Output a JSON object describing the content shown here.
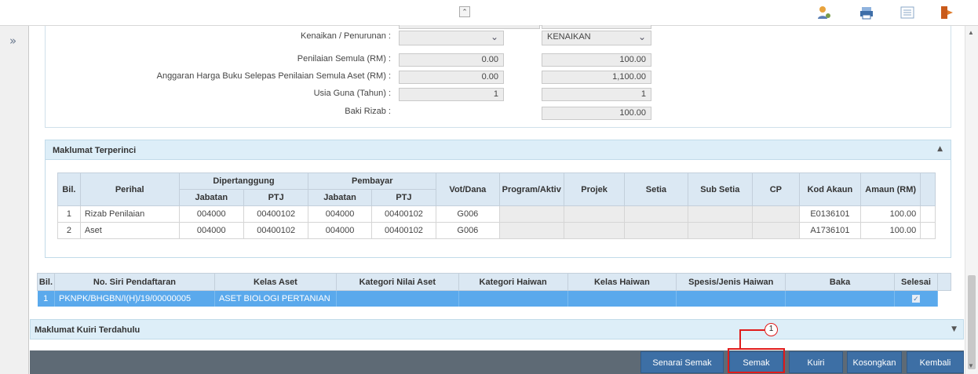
{
  "topbar": {
    "collapse_glyph": "⌃",
    "icons": [
      "user-settings-icon",
      "printer-icon",
      "list-view-icon",
      "logout-icon"
    ]
  },
  "left_rail": {
    "expand_glyph": "»"
  },
  "form": {
    "kenaikan_label": "Kenaikan / Penurunan :",
    "kenaikan_value": "KENAIKAN",
    "penilaian_label": "Penilaian Semula (RM) :",
    "penilaian_old": "0.00",
    "penilaian_new": "100.00",
    "anggaran_label": "Anggaran Harga Buku Selepas Penilaian Semula Aset (RM) :",
    "anggaran_old": "0.00",
    "anggaran_new": "1,100.00",
    "usia_label": "Usia Guna (Tahun) :",
    "usia_old": "1",
    "usia_new": "1",
    "baki_label": "Baki Rizab :",
    "baki_new": "100.00"
  },
  "detail": {
    "title": "Maklumat Terperinci",
    "headers": {
      "bil": "Bil.",
      "perihal": "Perihal",
      "dipertanggung": "Dipertanggung",
      "pembayar": "Pembayar",
      "jabatan": "Jabatan",
      "ptj": "PTJ",
      "vot": "Vot/Dana",
      "program": "Program/Aktiv",
      "projek": "Projek",
      "setia": "Setia",
      "subsetia": "Sub Setia",
      "cp": "CP",
      "kod": "Kod Akaun",
      "amaun": "Amaun (RM)"
    },
    "rows": [
      {
        "bil": "1",
        "perihal": "Rizab Penilaian",
        "d_jab": "004000",
        "d_ptj": "00400102",
        "p_jab": "004000",
        "p_ptj": "00400102",
        "vot": "G006",
        "kod": "E0136101",
        "amaun": "100.00"
      },
      {
        "bil": "2",
        "perihal": "Aset",
        "d_jab": "004000",
        "d_ptj": "00400102",
        "p_jab": "004000",
        "p_ptj": "00400102",
        "vot": "G006",
        "kod": "A1736101",
        "amaun": "100.00"
      }
    ]
  },
  "asset_grid": {
    "headers": {
      "bil": "Bil.",
      "siri": "No. Siri Pendaftaran",
      "kelas": "Kelas Aset",
      "kategori_nilai": "Kategori Nilai Aset",
      "kategori_haiwan": "Kategori Haiwan",
      "kelas_haiwan": "Kelas Haiwan",
      "spesis": "Spesis/Jenis Haiwan",
      "baka": "Baka",
      "selesai": "Selesai"
    },
    "row": {
      "bil": "1",
      "siri": "PKNPK/BHGBN/I(H)/19/00000005",
      "kelas": "ASET BIOLOGI PERTANIAN",
      "selesai_mark": "✓"
    }
  },
  "kuiri": {
    "title": "Maklumat Kuiri Terdahulu"
  },
  "buttons": {
    "senarai_semak": "Senarai Semak",
    "semak": "Semak",
    "kuiri": "Kuiri",
    "kosongkan": "Kosongkan",
    "kembali": "Kembali"
  },
  "callout": {
    "number": "1"
  },
  "colors": {
    "accent_blue": "#3d6fa5",
    "selected_row": "#5aa9ec",
    "highlight_red": "#e01b1b"
  }
}
